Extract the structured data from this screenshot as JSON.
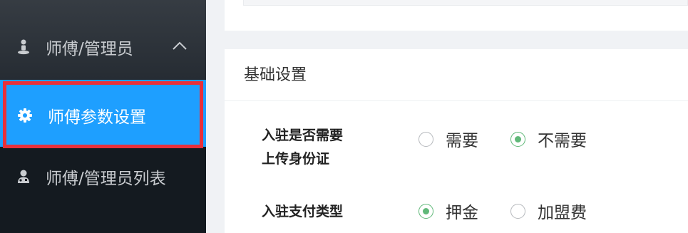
{
  "sidebar": {
    "group": {
      "label": "师傅/管理员",
      "icon": "user-pin-icon",
      "expanded": true
    },
    "items": [
      {
        "label": "师傅参数设置",
        "icon": "gear-icon",
        "active": true
      },
      {
        "label": "师傅/管理员列表",
        "icon": "user-doctor-icon",
        "active": false
      }
    ],
    "accent_color": "#1e9fff",
    "highlight_color": "#e8303a"
  },
  "section": {
    "title": "基础设置",
    "fields": [
      {
        "label_line1": "入驻是否需要",
        "label_line2": "上传身份证",
        "options": [
          {
            "label": "需要",
            "checked": false
          },
          {
            "label": "不需要",
            "checked": true
          }
        ]
      },
      {
        "label_line1": "入驻支付类型",
        "options": [
          {
            "label": "押金",
            "checked": true
          },
          {
            "label": "加盟费",
            "checked": false
          }
        ]
      }
    ],
    "radio_color": "#5fb878"
  }
}
